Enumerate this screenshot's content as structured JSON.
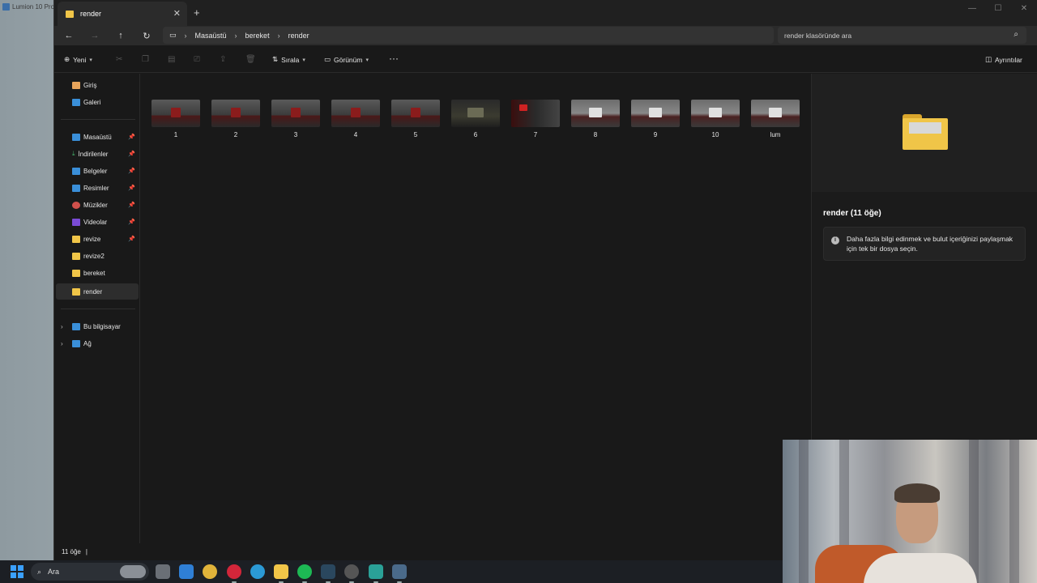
{
  "background": {
    "app_title": "Lumion 10 Pro"
  },
  "window": {
    "tab_title": "render",
    "new_tab_icon": "plus-icon"
  },
  "navigation": {
    "breadcrumb": [
      "Masaüstü",
      "bereket",
      "render"
    ],
    "search_placeholder": "render klasöründe ara"
  },
  "commandbar": {
    "new_label": "Yeni",
    "sort_label": "Sırala",
    "view_label": "Görünüm",
    "details_label": "Ayrıntılar"
  },
  "sidebar": {
    "quick": [
      {
        "label": "Giriş",
        "icon": "home-icon"
      },
      {
        "label": "Galeri",
        "icon": "gallery-icon"
      }
    ],
    "pinned": [
      {
        "label": "Masaüstü",
        "icon": "desktop-icon",
        "pinned": true
      },
      {
        "label": "İndirilenler",
        "icon": "download-icon",
        "pinned": true
      },
      {
        "label": "Belgeler",
        "icon": "documents-icon",
        "pinned": true
      },
      {
        "label": "Resimler",
        "icon": "pictures-icon",
        "pinned": true
      },
      {
        "label": "Müzikler",
        "icon": "music-icon",
        "pinned": true
      },
      {
        "label": "Videolar",
        "icon": "videos-icon",
        "pinned": true
      },
      {
        "label": "revize",
        "icon": "folder-icon",
        "pinned": true
      },
      {
        "label": "revize2",
        "icon": "folder-icon",
        "pinned": false
      },
      {
        "label": "bereket",
        "icon": "folder-icon",
        "pinned": false
      },
      {
        "label": "render",
        "icon": "folder-icon",
        "pinned": false,
        "active": true
      }
    ],
    "roots": [
      {
        "label": "Bu bilgisayar",
        "icon": "computer-icon"
      },
      {
        "label": "Ağ",
        "icon": "network-icon"
      }
    ]
  },
  "files": [
    "1",
    "2",
    "3",
    "4",
    "5",
    "6",
    "7",
    "8",
    "9",
    "10",
    "lum"
  ],
  "details_pane": {
    "title": "render (11 öğe)",
    "info": "Daha fazla bilgi edinmek ve bulut içeriğinizi paylaşmak için tek bir dosya seçin."
  },
  "statusbar": {
    "count": "11 öğe"
  },
  "taskbar": {
    "search_label": "Ara"
  },
  "colors": {
    "accent": "#3aa0ff",
    "folder": "#f0c548",
    "window_bg": "#191919"
  }
}
